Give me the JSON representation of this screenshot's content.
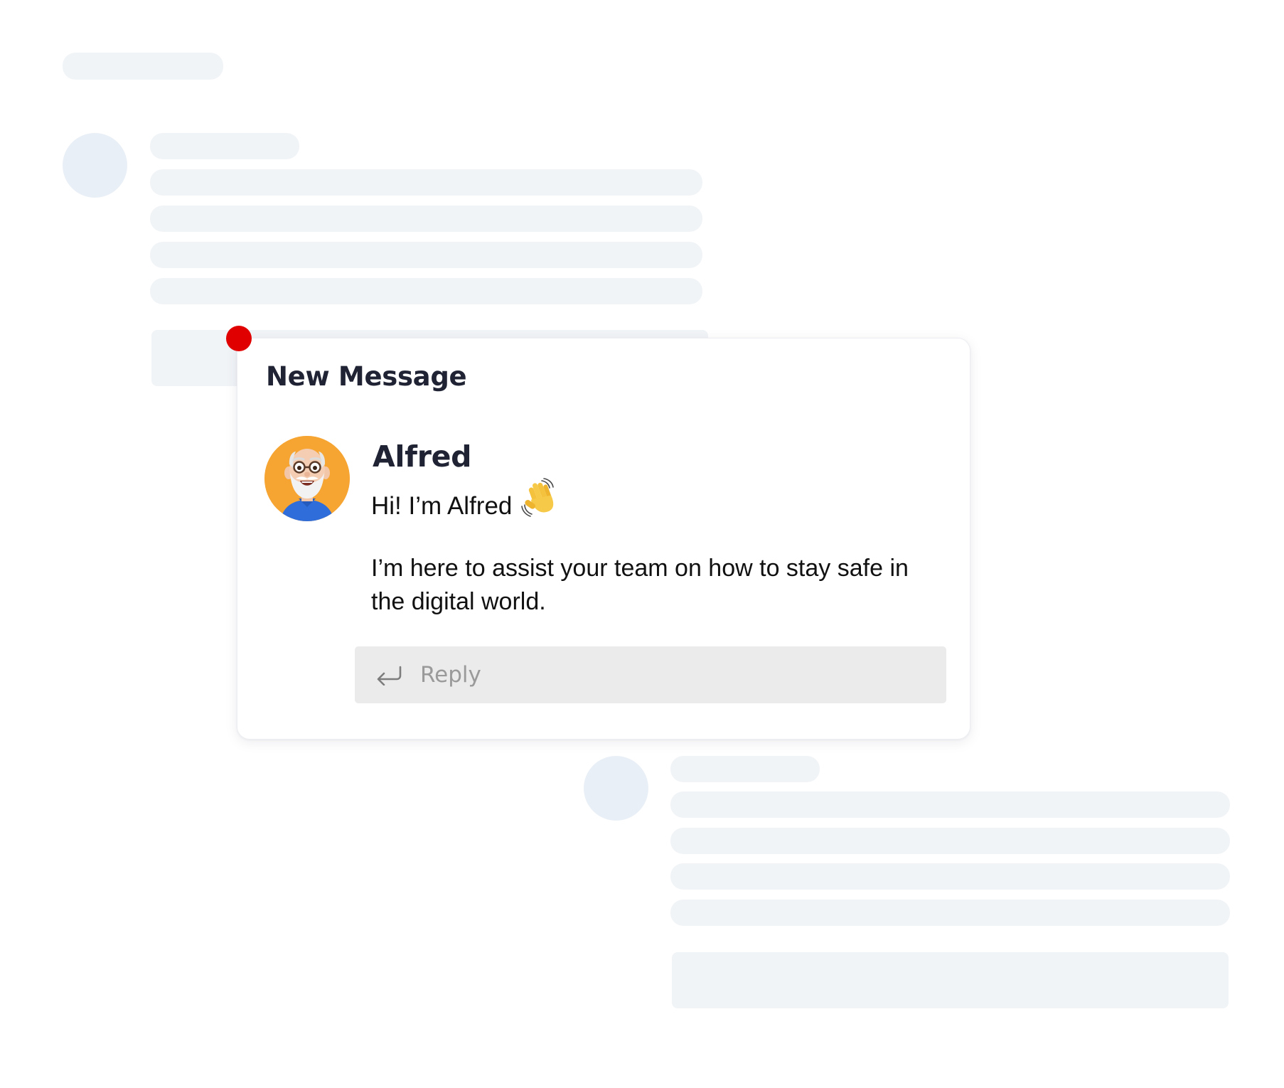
{
  "notification": {
    "title": "New Message",
    "indicator_color": "#e00000"
  },
  "message": {
    "sender": "Alfred",
    "greeting": "Hi! I’m Alfred",
    "greeting_emoji": "waving-hand-icon",
    "body": "I’m here to assist your team on how to stay safe in the digital world.",
    "avatar": "alfred-avatar"
  },
  "reply": {
    "placeholder": "Reply",
    "icon": "reply-arrow-icon"
  },
  "colors": {
    "skeleton": "#f1f4f7",
    "skeleton_avatar": "#e9eff6",
    "avatar_background": "#f6a532",
    "reply_background": "#ebebeb"
  }
}
